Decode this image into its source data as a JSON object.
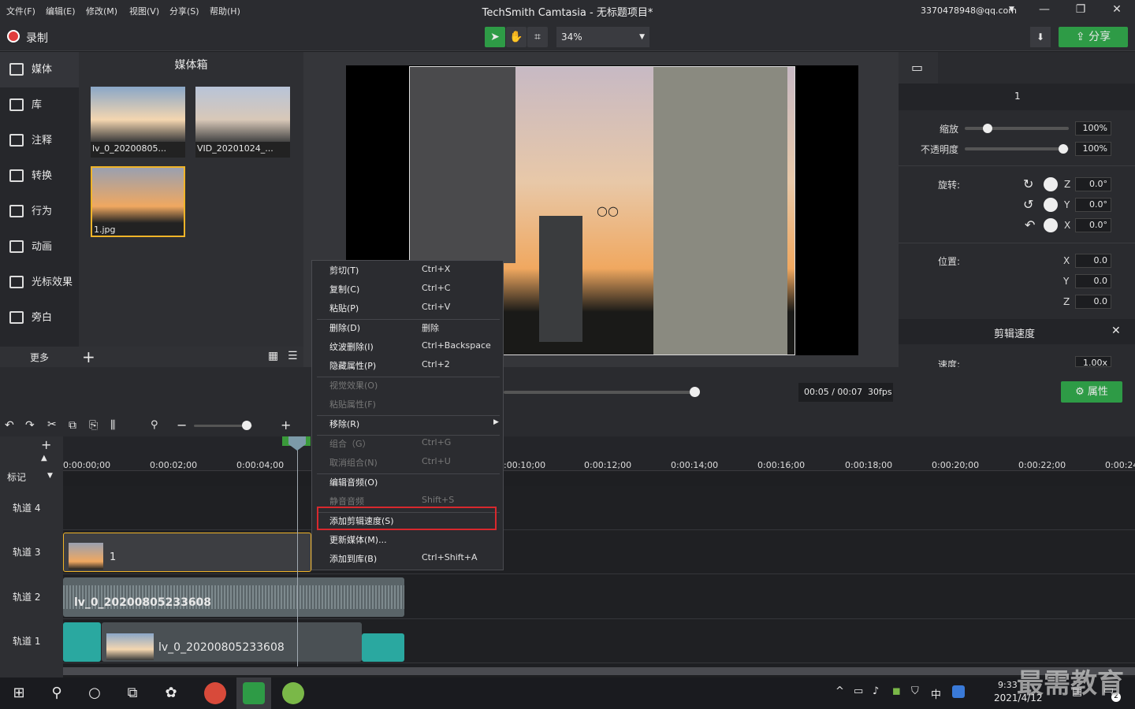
{
  "menu": [
    "文件(F)",
    "编辑(E)",
    "修改(M)",
    "视图(V)",
    "分享(S)",
    "帮助(H)"
  ],
  "title": "TechSmith Camtasia - 无标题项目*",
  "account": "3370478948@qq.com",
  "record": "录制",
  "zoom": "34%",
  "share": "分享",
  "nav": [
    "媒体",
    "库",
    "注释",
    "转换",
    "行为",
    "动画",
    "光标效果",
    "旁白"
  ],
  "more": "更多",
  "bin": {
    "title": "媒体箱",
    "items": [
      "lv_0_20200805...",
      "VID_20201024_...",
      "1.jpg"
    ]
  },
  "props": {
    "header": "1",
    "scale_label": "缩放",
    "scale": "100%",
    "opacity_label": "不透明度",
    "opacity": "100%",
    "rotation_label": "旋转:",
    "rz": "0.0°",
    "ry": "0.0°",
    "rx": "0.0°",
    "pos_label": "位置:",
    "px": "0.0",
    "py": "0.0",
    "pz": "0.0",
    "z": "Z",
    "y": "Y",
    "x": "X",
    "speed_title": "剪辑速度",
    "speed_label": "速度:",
    "speed": "1.00x"
  },
  "playback": {
    "time": "00:05 / 00:07",
    "fps": "30fps",
    "props_btn": "属性"
  },
  "ruler": [
    "0:00:00;00",
    "0:00:02;00",
    "0:00:04;00",
    "0:00:10;00",
    "0:00:12;00",
    "0:00:14;00",
    "0:00:16;00",
    "0:00:18;00",
    "0:00:20;00",
    "0:00:22;00",
    "0:00:24"
  ],
  "marker": "标记",
  "tracks": [
    "轨道 4",
    "轨道 3",
    "轨道 2",
    "轨道 1"
  ],
  "clips": {
    "t3": "1",
    "t2": "lv_0_20200805233608",
    "t1": "lv_0_20200805233608"
  },
  "context": [
    {
      "label": "剪切(T)",
      "shortcut": "Ctrl+X",
      "enabled": true
    },
    {
      "label": "复制(C)",
      "shortcut": "Ctrl+C",
      "enabled": true
    },
    {
      "label": "粘贴(P)",
      "shortcut": "Ctrl+V",
      "enabled": true
    },
    {
      "label": "删除(D)",
      "shortcut": "删除",
      "enabled": true
    },
    {
      "label": "纹波删除(I)",
      "shortcut": "Ctrl+Backspace",
      "enabled": true
    },
    {
      "label": "隐藏属性(P)",
      "shortcut": "Ctrl+2",
      "enabled": true
    },
    {
      "label": "视觉效果(O)",
      "shortcut": "",
      "enabled": false
    },
    {
      "label": "粘贴属性(F)",
      "shortcut": "",
      "enabled": false
    },
    {
      "label": "移除(R)",
      "shortcut": "",
      "enabled": true
    },
    {
      "label": "组合（G）",
      "shortcut": "Ctrl+G",
      "enabled": false
    },
    {
      "label": "取消组合(N)",
      "shortcut": "Ctrl+U",
      "enabled": false
    },
    {
      "label": "编辑音频(O)",
      "shortcut": "",
      "enabled": true
    },
    {
      "label": "静音音频",
      "shortcut": "Shift+S",
      "enabled": false
    },
    {
      "label": "添加剪辑速度(S)",
      "shortcut": "",
      "enabled": true
    },
    {
      "label": "更新媒体(M)...",
      "shortcut": "",
      "enabled": true
    },
    {
      "label": "添加到库(B)",
      "shortcut": "Ctrl+Shift+A",
      "enabled": true
    }
  ],
  "taskbar": {
    "time": "9:33",
    "date": "2021/4/12",
    "lang": "中",
    "notif": "2"
  },
  "watermark": "最需教育"
}
